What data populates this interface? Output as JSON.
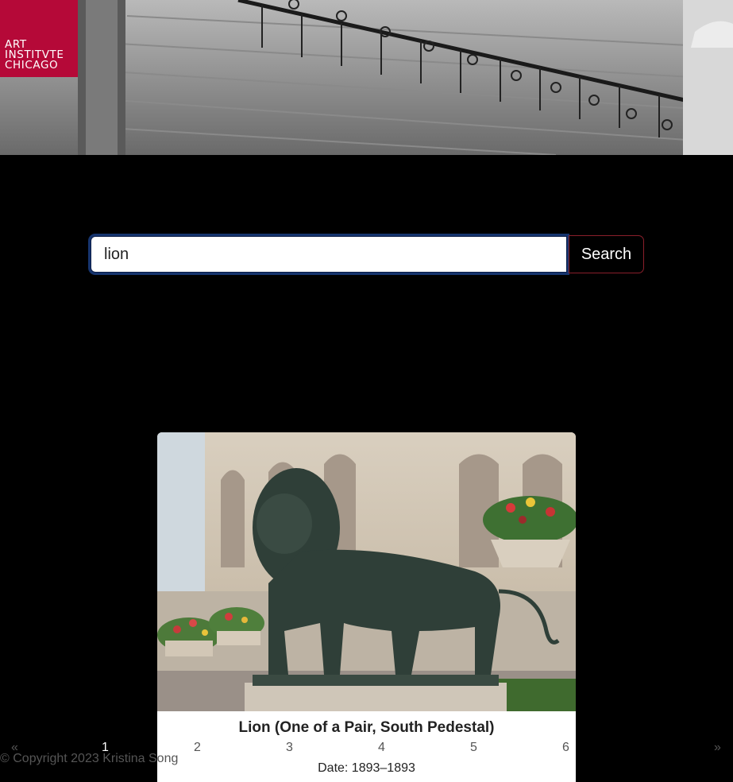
{
  "logo": {
    "lines": [
      "ART",
      "INSTITVTE",
      "CHICAGO"
    ]
  },
  "search": {
    "value": "lion",
    "button_label": "Search"
  },
  "result": {
    "title": "Lion (One of a Pair, South Pedestal)",
    "date": "Date: 1893–1893"
  },
  "pagination": {
    "prev": "«",
    "pages": [
      "1",
      "2",
      "3",
      "4",
      "5",
      "6"
    ],
    "active_page": "1",
    "next": "»"
  },
  "footer": {
    "copyright": "© Copyright 2023 Kristina Song"
  }
}
